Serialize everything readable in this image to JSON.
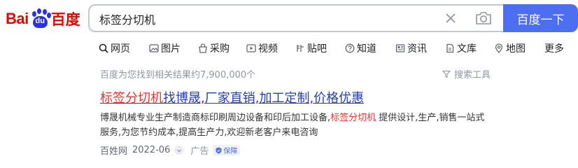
{
  "logo": {
    "bai": "Bai",
    "du": "du",
    "zh": "百度"
  },
  "search": {
    "query": "标签分切机",
    "button_label": "百度一下"
  },
  "tabs": [
    {
      "label": "网页",
      "icon": "search-icon"
    },
    {
      "label": "图片",
      "icon": "image-icon"
    },
    {
      "label": "采购",
      "icon": "shopping-icon"
    },
    {
      "label": "视频",
      "icon": "video-icon"
    },
    {
      "label": "贴吧",
      "icon": "tieba-icon"
    },
    {
      "label": "知道",
      "icon": "question-icon"
    },
    {
      "label": "资讯",
      "icon": "news-icon"
    },
    {
      "label": "文库",
      "icon": "document-icon"
    },
    {
      "label": "地图",
      "icon": "map-icon"
    },
    {
      "label": "更多",
      "icon": ""
    }
  ],
  "result_count": "百度为您找到相关结果约7,900,000个",
  "tools_label": "搜索工具",
  "result": {
    "title_hl": "标签分切机",
    "title_rest": "找博晟,厂家直销,加工定制,价格优惠",
    "desc_pre": "博晟机械专业生产制造商标印刷周边设备和印后加工设备,",
    "desc_hl": "标签分切机",
    "desc_post": " 提供设计,生产,销售一站式服务,为您节约成本,提高生产力,欢迎新老客户来电咨询",
    "source": "百姓网",
    "date": "2022-06",
    "ad_label": "广告",
    "badge_label": "保障"
  },
  "colors": {
    "brand_blue": "#4e6ef2",
    "highlight_red": "#f73131",
    "link_blue": "#2440b3",
    "logo_red": "#e10602"
  }
}
